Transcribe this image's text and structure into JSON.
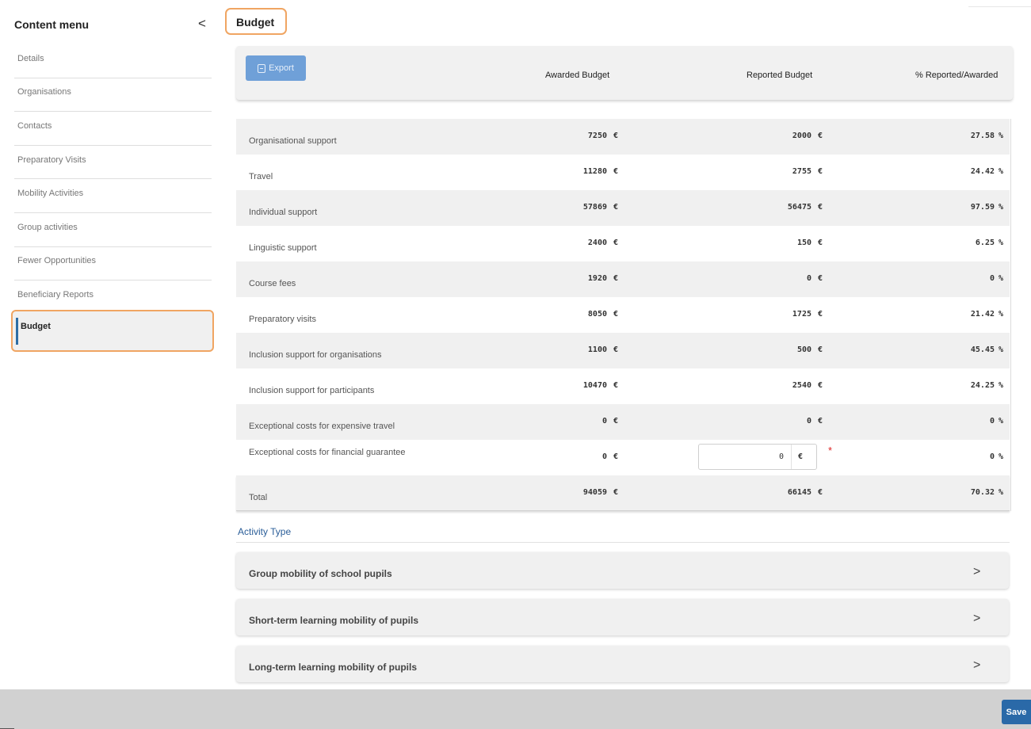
{
  "sidebar": {
    "title": "Content menu",
    "collapse_icon": "<",
    "items": [
      {
        "label": "Details"
      },
      {
        "label": "Organisations"
      },
      {
        "label": "Contacts"
      },
      {
        "label": "Preparatory Visits"
      },
      {
        "label": "Mobility Activities"
      },
      {
        "label": "Group activities"
      },
      {
        "label": "Fewer Opportunities"
      },
      {
        "label": "Beneficiary Reports"
      },
      {
        "label": "Budget",
        "active": true
      }
    ]
  },
  "page": {
    "title": "Budget"
  },
  "toolbar": {
    "export_label": "Export",
    "col_awarded": "Awarded Budget",
    "col_reported": "Reported Budget",
    "col_percent": "% Reported/Awarded"
  },
  "table": {
    "currency": "€",
    "percent_unit": "%",
    "rows": [
      {
        "label": "Organisational support",
        "awarded": "7250",
        "reported": "2000",
        "percent": "27.58"
      },
      {
        "label": "Travel",
        "awarded": "11280",
        "reported": "2755",
        "percent": "24.42"
      },
      {
        "label": "Individual support",
        "awarded": "57869",
        "reported": "56475",
        "percent": "97.59"
      },
      {
        "label": "Linguistic support",
        "awarded": "2400",
        "reported": "150",
        "percent": "6.25"
      },
      {
        "label": "Course fees",
        "awarded": "1920",
        "reported": "0",
        "percent": "0"
      },
      {
        "label": "Preparatory visits",
        "awarded": "8050",
        "reported": "1725",
        "percent": "21.42"
      },
      {
        "label": "Inclusion support for organisations",
        "awarded": "1100",
        "reported": "500",
        "percent": "45.45"
      },
      {
        "label": "Inclusion support for participants",
        "awarded": "10470",
        "reported": "2540",
        "percent": "24.25"
      },
      {
        "label": "Exceptional costs for expensive travel",
        "awarded": "0",
        "reported": "0",
        "percent": "0"
      },
      {
        "label": "Exceptional costs for financial guarantee",
        "awarded": "0",
        "reported_input": "0",
        "required": "*",
        "percent": "0"
      },
      {
        "label": "Total",
        "awarded": "94059",
        "reported": "66145",
        "percent": "70.32"
      }
    ]
  },
  "activity": {
    "title": "Activity Type",
    "items": [
      {
        "label": "Group mobility of school pupils"
      },
      {
        "label": "Short-term learning mobility of pupils"
      },
      {
        "label": "Long-term learning mobility of pupils"
      }
    ],
    "chevron": ">"
  },
  "footer": {
    "save_label": "Save"
  },
  "colors": {
    "accent": "#2a69a8",
    "highlight": "#f0a562",
    "export_button": "#6fa0d8"
  }
}
